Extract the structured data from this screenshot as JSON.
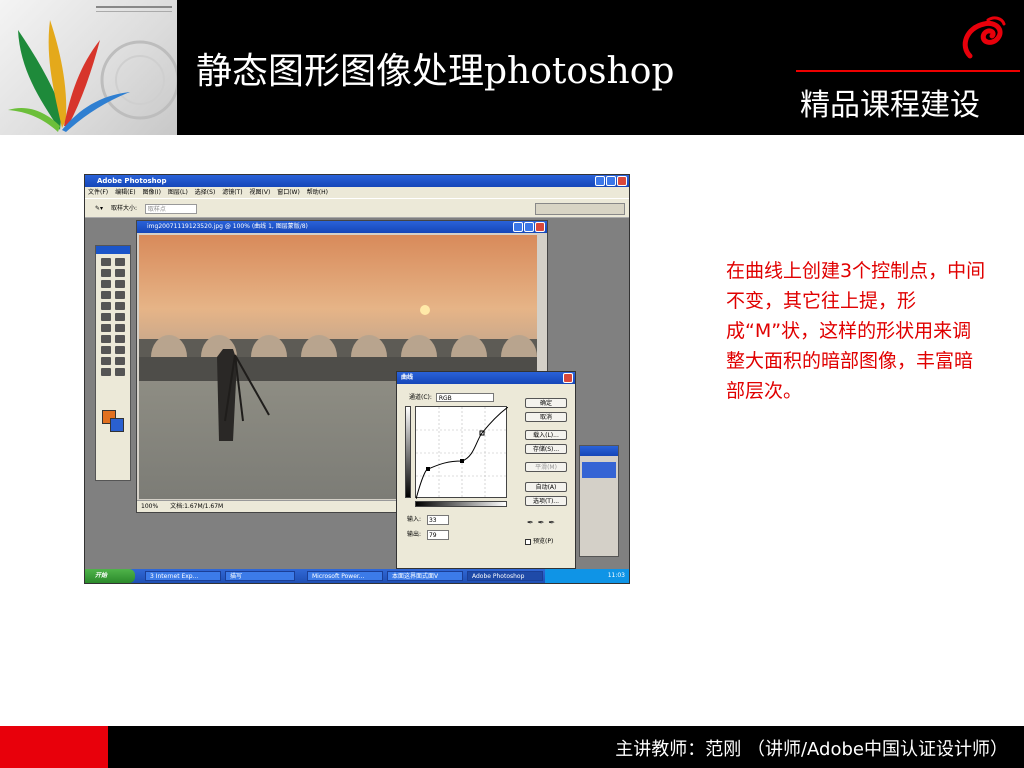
{
  "banner": {
    "title": "静态图形图像处理photoshop",
    "subtitle": "精品课程建设"
  },
  "description": "在曲线上创建3个控制点，中间不变，其它往上提，形成“M”状，这样的形状用来调整大面积的暗部图像，丰富暗部层次。",
  "footer": {
    "lecturer": "主讲教师：范刚 （讲师/Adobe中国认证设计师）"
  },
  "colors": {
    "banner_bg": "#000000",
    "accent_red": "#e8000b",
    "description_text": "#e00000"
  },
  "photoshop": {
    "window_title": "Adobe Photoshop",
    "menu": [
      "文件(F)",
      "编辑(E)",
      "图像(I)",
      "图层(L)",
      "选择(S)",
      "滤镜(T)",
      "视图(V)",
      "窗口(W)",
      "帮助(H)"
    ],
    "options_label": "取样大小:",
    "options_value": "取样点",
    "document": {
      "title": "img20071119123520.jpg @ 100% (曲线 1, 图层蒙版/8)",
      "zoom": "100%",
      "doc_info": "文档:1.67M/1.67M"
    },
    "curves_dialog": {
      "title": "曲线",
      "channel_label": "通道(C):",
      "channel_value": "RGB",
      "buttons": [
        "确定",
        "取消",
        "载入(L)...",
        "存储(S)...",
        "平滑(M)",
        "自动(A)",
        "选项(T)..."
      ],
      "input_label": "输入:",
      "input_value": "33",
      "output_label": "输出:",
      "output_value": "79",
      "preview_label": "预览(P)"
    },
    "taskbar": {
      "start_label": "开始",
      "tasks": [
        "3 Internet Exp...",
        "描写",
        "Microsoft Power...",
        "本面这界面式面V",
        "Adobe Photoshop"
      ],
      "clock": "11:03"
    }
  }
}
